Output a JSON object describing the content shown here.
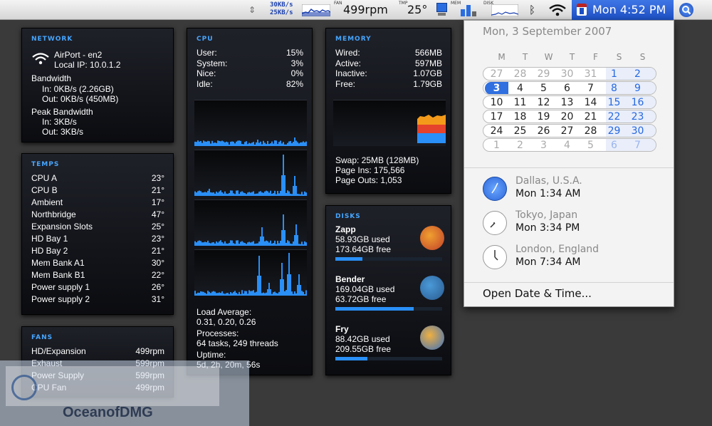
{
  "menubar": {
    "net_up": "30KB/s",
    "net_down": "25KB/s",
    "fan_label": "FAN",
    "fan_value": "499rpm",
    "temp_label": "TMP",
    "temp_value": "25°",
    "mem_label": "MEM",
    "disk_label": "DISK",
    "clock": "Mon 4:52 PM"
  },
  "network": {
    "title": "NETWORK",
    "interface": "AirPort - en2",
    "local_ip": "Local IP: 10.0.1.2",
    "bandwidth_label": "Bandwidth",
    "bw_in": "In:  0KB/s (2.26GB)",
    "bw_out": "Out: 0KB/s (450MB)",
    "peak_label": "Peak Bandwidth",
    "peak_in": "In:  3KB/s",
    "peak_out": "Out: 3KB/s"
  },
  "temps": {
    "title": "TEMPS",
    "items": [
      {
        "name": "CPU A",
        "value": "23°"
      },
      {
        "name": "CPU B",
        "value": "21°"
      },
      {
        "name": "Ambient",
        "value": "17°"
      },
      {
        "name": "Northbridge",
        "value": "47°"
      },
      {
        "name": "Expansion Slots",
        "value": "25°"
      },
      {
        "name": "HD Bay 1",
        "value": "23°"
      },
      {
        "name": "HD Bay 2",
        "value": "21°"
      },
      {
        "name": "Mem Bank A1",
        "value": "30°"
      },
      {
        "name": "Mem Bank B1",
        "value": "22°"
      },
      {
        "name": "Power supply 1",
        "value": "26°"
      },
      {
        "name": "Power supply 2",
        "value": "31°"
      }
    ]
  },
  "fans": {
    "title": "FANS",
    "items": [
      {
        "name": "HD/Expansion",
        "value": "499rpm"
      },
      {
        "name": "Exhaust",
        "value": "599rpm"
      },
      {
        "name": "Power Supply",
        "value": "599rpm"
      },
      {
        "name": "CPU Fan",
        "value": "499rpm"
      }
    ]
  },
  "cpu": {
    "title": "CPU",
    "stats": [
      {
        "name": "User:",
        "value": "15%"
      },
      {
        "name": "System:",
        "value": "3%"
      },
      {
        "name": "Nice:",
        "value": "0%"
      },
      {
        "name": "Idle:",
        "value": "82%"
      }
    ],
    "load_label": "Load Average:",
    "load_values": "0.31, 0.20, 0.26",
    "proc_label": "Processes:",
    "proc_values": "64 tasks, 249 threads",
    "uptime_label": "Uptime:",
    "uptime_value": "5d, 2h, 20m, 56s"
  },
  "memory": {
    "title": "MEMORY",
    "stats": [
      {
        "name": "Wired:",
        "value": "566MB"
      },
      {
        "name": "Active:",
        "value": "597MB"
      },
      {
        "name": "Inactive:",
        "value": "1.07GB"
      },
      {
        "name": "Free:",
        "value": "1.79GB"
      }
    ],
    "swap": "Swap: 25MB (128MB)",
    "page_ins": "Page Ins: 175,566",
    "page_outs": "Page Outs: 1,053"
  },
  "disks": {
    "title": "DISKS",
    "items": [
      {
        "name": "Zapp",
        "used": "58.93GB used",
        "free": "173.64GB free",
        "fill": 0.25
      },
      {
        "name": "Bender",
        "used": "169.04GB used",
        "free": "63.72GB free",
        "fill": 0.73
      },
      {
        "name": "Fry",
        "used": "88.42GB used",
        "free": "209.55GB free",
        "fill": 0.3
      }
    ]
  },
  "calendar": {
    "date_header": "Mon, 3 September 2007",
    "weekdays": [
      "M",
      "T",
      "W",
      "T",
      "F",
      "S",
      "S"
    ],
    "weeks": [
      [
        "27",
        "28",
        "29",
        "30",
        "31",
        "1",
        "2"
      ],
      [
        "3",
        "4",
        "5",
        "6",
        "7",
        "8",
        "9"
      ],
      [
        "10",
        "11",
        "12",
        "13",
        "14",
        "15",
        "16"
      ],
      [
        "17",
        "18",
        "19",
        "20",
        "21",
        "22",
        "23"
      ],
      [
        "24",
        "25",
        "26",
        "27",
        "28",
        "29",
        "30"
      ],
      [
        "1",
        "2",
        "3",
        "4",
        "5",
        "6",
        "7"
      ]
    ],
    "clocks": [
      {
        "city": "Dallas, U.S.A.",
        "time": "Mon 1:34 AM"
      },
      {
        "city": "Tokyo, Japan",
        "time": "Mon 3:34 PM"
      },
      {
        "city": "London, England",
        "time": "Mon 7:34 AM"
      }
    ],
    "open_label": "Open Date & Time..."
  },
  "colors": {
    "accent": "#46a6ff",
    "graph_bar": "#2a8ff7",
    "mem_orange": "#f39a1b",
    "mem_red": "#e5432b"
  },
  "watermark": "OceanofDMG"
}
